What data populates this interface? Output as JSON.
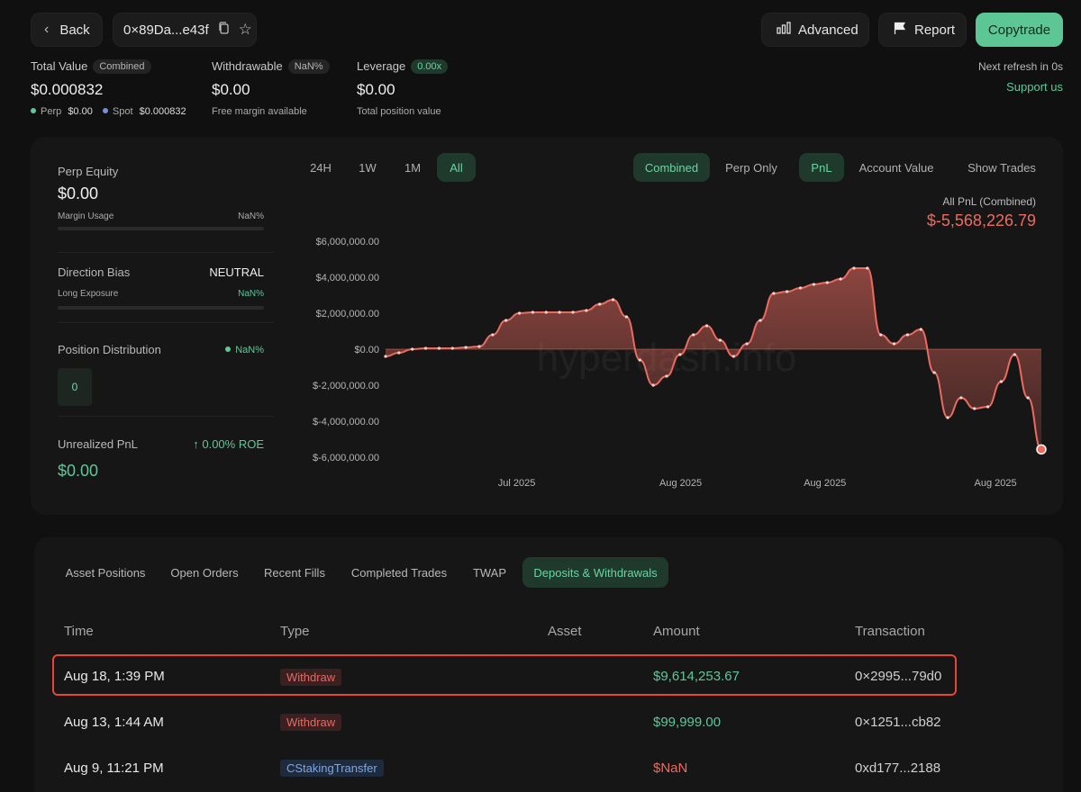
{
  "header": {
    "back_label": "Back",
    "address": "0×89Da...e43f",
    "advanced_label": "Advanced",
    "report_label": "Report",
    "copytrade_label": "Copytrade",
    "refresh_text": "Next refresh in 0s",
    "support_label": "Support us"
  },
  "summary": {
    "total_value": {
      "label": "Total Value",
      "tag": "Combined",
      "value": "$0.000832",
      "perp_label": "Perp",
      "perp_value": "$0.00",
      "spot_label": "Spot",
      "spot_value": "$0.000832"
    },
    "withdrawable": {
      "label": "Withdrawable",
      "tag": "NaN%",
      "value": "$0.00",
      "sub": "Free margin available"
    },
    "leverage": {
      "label": "Leverage",
      "tag": "0.00x",
      "value": "$0.00",
      "sub": "Total position value"
    }
  },
  "side": {
    "perp_equity": {
      "label": "Perp Equity",
      "value": "$0.00",
      "margin_label": "Margin Usage",
      "margin_value": "NaN%"
    },
    "direction": {
      "label": "Direction Bias",
      "value": "NEUTRAL",
      "long_label": "Long Exposure",
      "long_value": "NaN%"
    },
    "distribution": {
      "label": "Position Distribution",
      "value": "NaN%",
      "box_value": "0"
    },
    "unrealized": {
      "label": "Unrealized PnL",
      "roe": "↑ 0.00% ROE",
      "value": "$0.00"
    }
  },
  "chart_controls": {
    "timeframes": [
      "24H",
      "1W",
      "1M",
      "All"
    ],
    "active_timeframe": "All",
    "modes": [
      "Combined",
      "Perp Only"
    ],
    "metrics": [
      "PnL",
      "Account Value"
    ],
    "show_trades": "Show Trades"
  },
  "chart_data": {
    "type": "area",
    "title": "All PnL (Combined)",
    "headline_value": "$-5,568,226.79",
    "y_ticks": [
      "$6,000,000.00",
      "$4,000,000.00",
      "$2,000,000.00",
      "$0.00",
      "$-2,000,000.00",
      "$-4,000,000.00",
      "$-6,000,000.00"
    ],
    "x_ticks": [
      "Jul 2025",
      "Aug 2025",
      "Aug 2025",
      "Aug 2025"
    ],
    "ylim": [
      -6000000,
      6000000
    ],
    "watermark": "hyperdash.info",
    "series": [
      {
        "values": [
          -400000,
          -200000,
          0,
          50000,
          50000,
          50000,
          100000,
          150000,
          800000,
          1600000,
          2000000,
          2050000,
          2050000,
          2050000,
          2050000,
          2150000,
          2500000,
          2750000,
          1800000,
          -600000,
          -2000000,
          -1500000,
          -300000,
          800000,
          1300000,
          500000,
          -400000,
          300000,
          1600000,
          3100000,
          3200000,
          3400000,
          3600000,
          3700000,
          3900000,
          4500000,
          4500000,
          800000,
          300000,
          800000,
          1100000,
          -1300000,
          -3800000,
          -2700000,
          -3300000,
          -3200000,
          -1800000,
          -300000,
          -2700000,
          -5568226.79
        ],
        "color": "#ec6b60"
      }
    ]
  },
  "tabs": [
    "Asset Positions",
    "Open Orders",
    "Recent Fills",
    "Completed Trades",
    "TWAP",
    "Deposits & Withdrawals"
  ],
  "active_tab": "Deposits & Withdrawals",
  "table": {
    "columns": [
      "Time",
      "Type",
      "Asset",
      "Amount",
      "Transaction"
    ],
    "rows": [
      {
        "time": "Aug 18, 1:39 PM",
        "type": "Withdraw",
        "asset": "",
        "amount": "$9,614,253.67",
        "tx": "0×2995...79d0"
      },
      {
        "time": "Aug 13, 1:44 AM",
        "type": "Withdraw",
        "asset": "",
        "amount": "$99,999.00",
        "tx": "0×1251...cb82"
      },
      {
        "time": "Aug 9, 11:21 PM",
        "type": "CStakingTransfer",
        "asset": "",
        "amount": "$NaN",
        "tx": "0xd177...2188"
      }
    ]
  },
  "colors": {
    "accent": "#5fc79a",
    "negative": "#ec6b60",
    "highlight": "#e6453a"
  }
}
